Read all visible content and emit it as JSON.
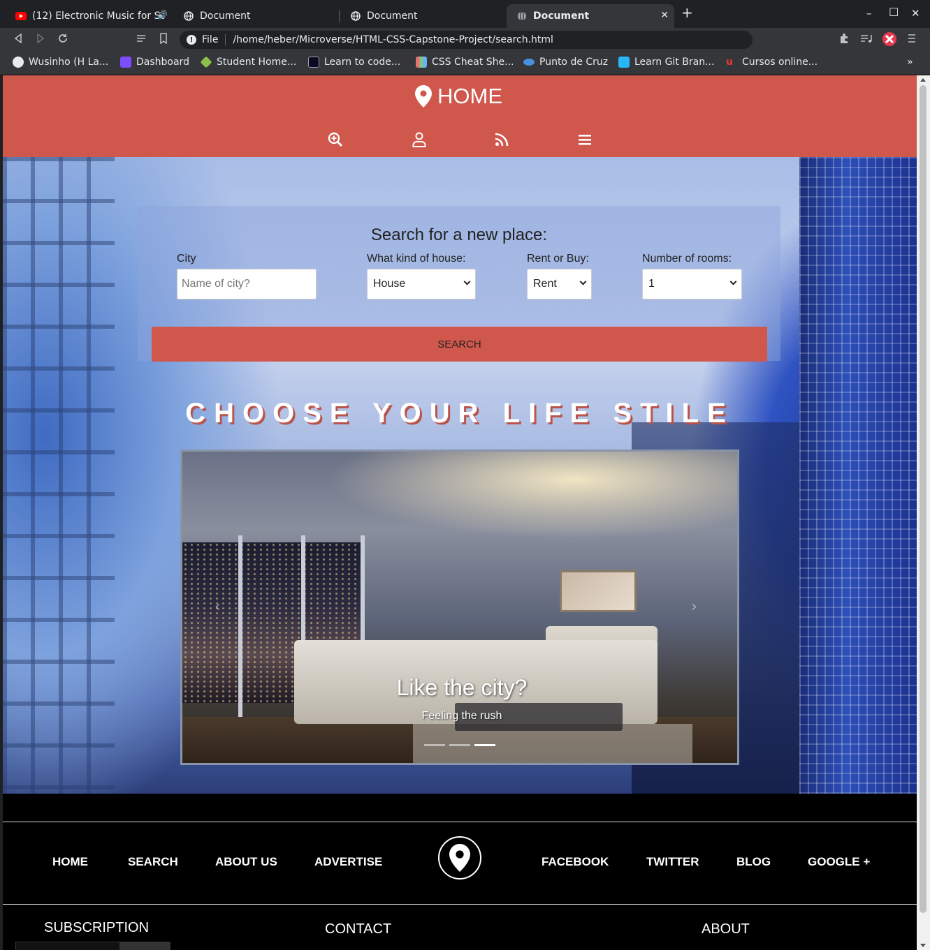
{
  "browser": {
    "tabs": [
      {
        "title": "(12) Electronic Music for St",
        "icon": "youtube-icon",
        "active": false
      },
      {
        "title": "Document",
        "icon": "globe-icon",
        "active": false
      },
      {
        "title": "Document",
        "icon": "globe-icon",
        "active": false
      },
      {
        "title": "Document",
        "icon": "globe-icon",
        "active": true
      }
    ],
    "new_tab": "+",
    "window_controls": {
      "minimize": "–",
      "maximize": "□",
      "close": "✕"
    },
    "address": {
      "scheme_label": "File",
      "url": "/home/heber/Microverse/HTML-CSS-Capstone-Project/search.html"
    },
    "bookmarks": [
      {
        "label": "Wusinho (H La...",
        "icon": "github-icon",
        "color": "#ffffff"
      },
      {
        "label": "Dashboard",
        "icon": "dashboard-icon",
        "color": "#7c4dff"
      },
      {
        "label": "Student Home...",
        "icon": "microverse-icon",
        "color": "#8bc34a"
      },
      {
        "label": "Learn to code...",
        "icon": "freecodecamp-icon",
        "color": "#0a0a23"
      },
      {
        "label": "CSS Cheat She...",
        "icon": "css-icon",
        "color": "#e57373"
      },
      {
        "label": "Punto de Cruz",
        "icon": "bookmark-icon",
        "color": "#4a90e2"
      },
      {
        "label": "Learn Git Bran...",
        "icon": "git-icon",
        "color": "#29b6f6"
      },
      {
        "label": "Cursos online...",
        "icon": "udemy-icon",
        "color": "#e53935"
      }
    ],
    "bookmarks_overflow": "»"
  },
  "header": {
    "brand": "HOME",
    "nav_icons": [
      "search-icon",
      "user-icon",
      "rss-icon",
      "menu-icon"
    ],
    "bg_color": "#d0574c"
  },
  "search": {
    "title": "Search for a new place:",
    "city_label": "City",
    "city_placeholder": "Name of city?",
    "house_label": "What kind of house:",
    "house_value": "House",
    "mode_label": "Rent or Buy:",
    "mode_value": "Rent",
    "rooms_label": "Number of rooms:",
    "rooms_value": "1",
    "button": "SEARCH"
  },
  "lifestyle_title": "CHOOSE YOUR LIFE STILE",
  "carousel": {
    "caption_title": "Like the city?",
    "caption_sub": "Feeling the rush",
    "slide_count": 3,
    "active_index": 2
  },
  "footer": {
    "left_links": [
      "HOME",
      "SEARCH",
      "ABOUT US",
      "ADVERTISE"
    ],
    "right_links": [
      "FACEBOOK",
      "TWITTER",
      "BLOG",
      "GOOGLE +"
    ],
    "logo_icon": "map-pin-icon",
    "subscription_heading": "SUBSCRIPTION",
    "contact_heading": "CONTACT",
    "about_heading": "ABOUT"
  }
}
